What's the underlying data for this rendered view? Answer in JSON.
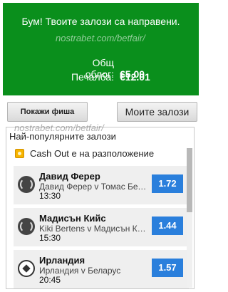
{
  "banner": {
    "message": "Бум! Твоите залози са направени.",
    "watermark": "nostrabet.com/betfair/",
    "total_stake_label": "Общ облог:",
    "total_stake_value": "€5.00",
    "winnings_label": "Печалба:",
    "winnings_value": "€12.01",
    "color": "#0a8f1c"
  },
  "buttons": {
    "show_slip": "Покажи фиша",
    "my_bets": "Моите залози"
  },
  "popular": {
    "title": "Най-популярните залози",
    "cashout_label": "Cash Out е на разположение",
    "cashout_icon": "cashout-coin-icon",
    "odds_color": "#2a7fdc",
    "items": [
      {
        "name": "Давид Ферер",
        "event": "Давид Ферер v Томас Белуччи",
        "time": "13:30",
        "odds": "1.72",
        "icon": "tennis-ball-icon"
      },
      {
        "name": "Мадисън Кийс",
        "event": "Kiki Bertens v Мадисън Кийс",
        "time": "15:30",
        "odds": "1.44",
        "icon": "tennis-ball-icon"
      },
      {
        "name": "Ирландия",
        "event": "Ирландия v Беларус",
        "time": "20:45",
        "odds": "1.57",
        "icon": "soccer-ball-icon"
      }
    ],
    "watermark": "nostrabet.com/betfair/"
  }
}
